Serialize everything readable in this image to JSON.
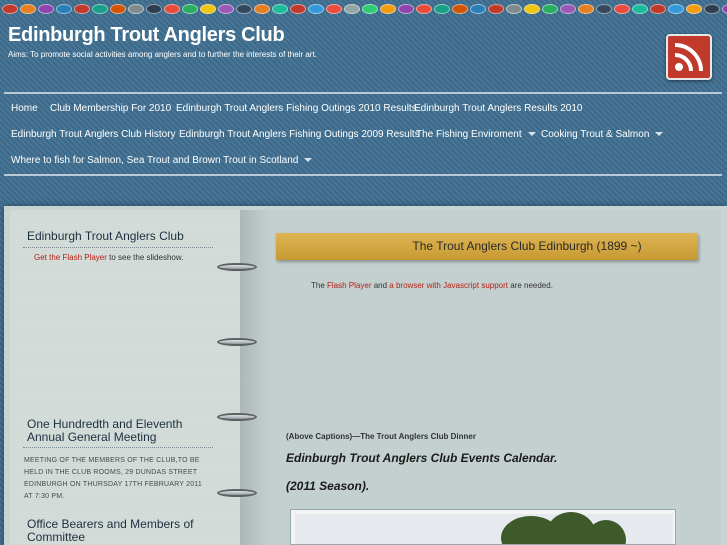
{
  "header": {
    "site_title": "Edinburgh Trout Anglers Club",
    "aims": "Aims: To promote social activities among anglers and to further the interests of their art.",
    "rss_icon": "rss-feed-icon",
    "fly_colors": [
      "#c0392b",
      "#e67e22",
      "#8e44ad",
      "#2980b9",
      "#c0392b",
      "#16a085",
      "#d35400",
      "#7f8c8d",
      "#2c3e50",
      "#e74c3c",
      "#27ae60",
      "#f1c40f",
      "#9b59b6",
      "#34495e",
      "#e67e22",
      "#1abc9c",
      "#c0392b",
      "#3498db",
      "#e74c3c",
      "#95a5a6",
      "#2ecc71",
      "#f39c12",
      "#8e44ad",
      "#e74c3c",
      "#16a085",
      "#d35400",
      "#2980b9",
      "#c0392b",
      "#7f8c8d",
      "#f1c40f",
      "#27ae60",
      "#9b59b6",
      "#e67e22",
      "#34495e",
      "#e74c3c",
      "#1abc9c",
      "#c0392b",
      "#3498db",
      "#f39c12",
      "#2c3e50",
      "#8e44ad",
      "#e74c3c",
      "#16a085"
    ]
  },
  "nav": {
    "items": [
      {
        "label": "Home",
        "dropdown": false
      },
      {
        "label": "Club Membership For 2010",
        "dropdown": false
      },
      {
        "label": "Edinburgh Trout Anglers Fishing Outings 2010 Results",
        "dropdown": false
      },
      {
        "label": "Edinburgh Trout Anglers Results 2010",
        "dropdown": false
      },
      {
        "label": "Edinburgh Trout Anglers Club History",
        "dropdown": false
      },
      {
        "label": "Edinburgh Trout Anglers Fishing Outings 2009 Results",
        "dropdown": false
      },
      {
        "label": "The Fishing Enviroment",
        "dropdown": true
      },
      {
        "label": "Cooking Trout & Salmon",
        "dropdown": true
      },
      {
        "label": "Where to fish for Salmon, Sea Trout and Brown Trout in Scotland",
        "dropdown": true
      }
    ]
  },
  "sidebar": {
    "widget1_title": "Edinburgh Trout Anglers Club",
    "flash_link": "Get the Flash Player",
    "flash_suffix": " to see the slideshow.",
    "widget2_title": "One Hundredth and Eleventh Annual General Meeting",
    "meeting_text": "MEETING OF THE MEMBERS OF THE CLUB,TO BE HELD IN THE CLUB ROOMS, 29 DUNDAS STREET EDINBURGH ON THURSDAY 17TH FEBRUARY 2011 AT 7:30 PM.",
    "widget3_title": "Office Bearers and Members of Committee"
  },
  "main": {
    "banner": "The Trout Anglers Club Edinburgh (1899 ~)",
    "flash_note_prefix": "The ",
    "flash_player_link": "Flash Player",
    "flash_note_mid": " and ",
    "browser_link": "a browser with Javascript support",
    "flash_note_suffix": " are needed.",
    "caption": "(Above Captions)—The Trout Anglers Club Dinner",
    "calendar_title": "Edinburgh Trout Anglers Club Events Calendar.",
    "season": "(2011 Season)."
  }
}
